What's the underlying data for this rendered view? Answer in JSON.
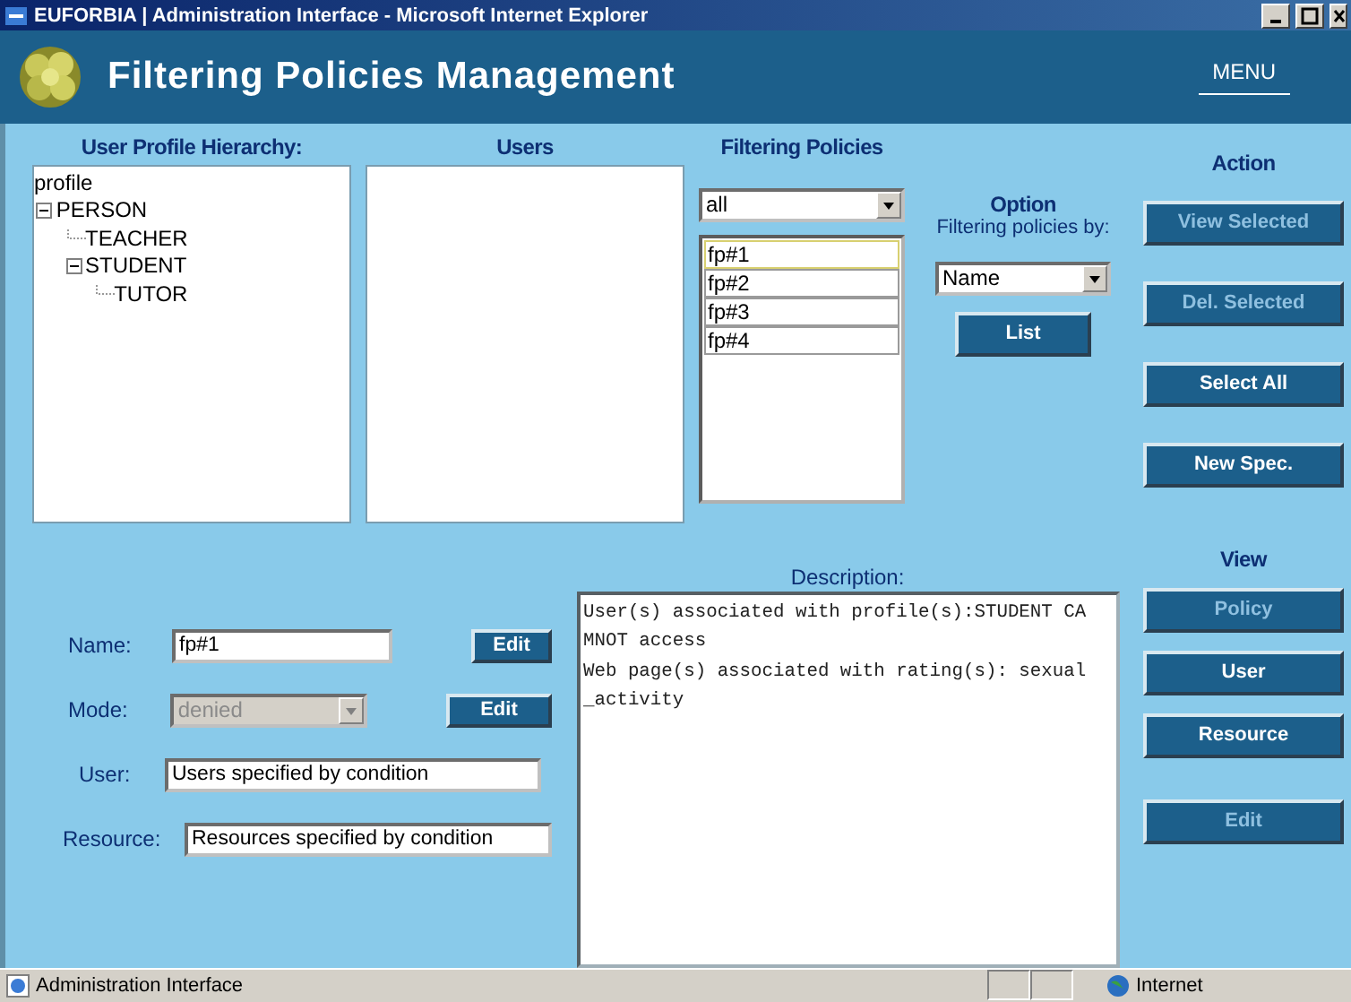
{
  "window": {
    "title": "EUFORBIA | Administration Interface - Microsoft Internet Explorer"
  },
  "header": {
    "title": "Filtering Policies Management",
    "menu": "MENU"
  },
  "hierarchy": {
    "heading": "User Profile Hierarchy:",
    "root": "profile",
    "children": [
      {
        "label": "PERSON",
        "expanded": true,
        "children": [
          {
            "label": "TEACHER"
          },
          {
            "label": "STUDENT",
            "expanded": true,
            "children": [
              {
                "label": "TUTOR"
              }
            ]
          }
        ]
      }
    ]
  },
  "users": {
    "heading": "Users"
  },
  "policies": {
    "heading": "Filtering Policies",
    "filter": "all",
    "items": [
      {
        "label": "fp#1",
        "selected": true
      },
      {
        "label": "fp#2",
        "selected": false
      },
      {
        "label": "fp#3",
        "selected": false
      },
      {
        "label": "fp#4",
        "selected": false
      }
    ]
  },
  "option": {
    "heading": "Option",
    "caption": "Filtering policies by:",
    "sort": "Name",
    "button": "List"
  },
  "action": {
    "heading": "Action",
    "buttons": [
      {
        "label": "View Selected",
        "disabled": true
      },
      {
        "label": "Del. Selected",
        "disabled": true
      },
      {
        "label": "Select All",
        "disabled": false
      },
      {
        "label": "New Spec.",
        "disabled": false
      }
    ]
  },
  "form": {
    "name": {
      "label": "Name:",
      "value": "fp#1",
      "button": "Edit"
    },
    "mode": {
      "label": "Mode:",
      "value": "denied",
      "disabled": true,
      "button": "Edit"
    },
    "user": {
      "label": "User:",
      "value": "Users specified by condition"
    },
    "resource": {
      "label": "Resource:",
      "value": "Resources specified by condition"
    }
  },
  "description": {
    "label": "Description:",
    "lines": [
      "User(s) associated with profile(s):STUDENT CA",
      "MNOT access",
      "Web page(s) associated with rating(s): sexual",
      "_activity"
    ]
  },
  "view": {
    "heading": "View",
    "buttons": [
      {
        "label": "Policy",
        "disabled": true
      },
      {
        "label": "User",
        "disabled": false
      },
      {
        "label": "Resource",
        "disabled": false
      },
      {
        "label": "Edit",
        "disabled": true
      }
    ]
  },
  "status_bar": {
    "text": "Administration Interface",
    "zone": "Internet"
  }
}
